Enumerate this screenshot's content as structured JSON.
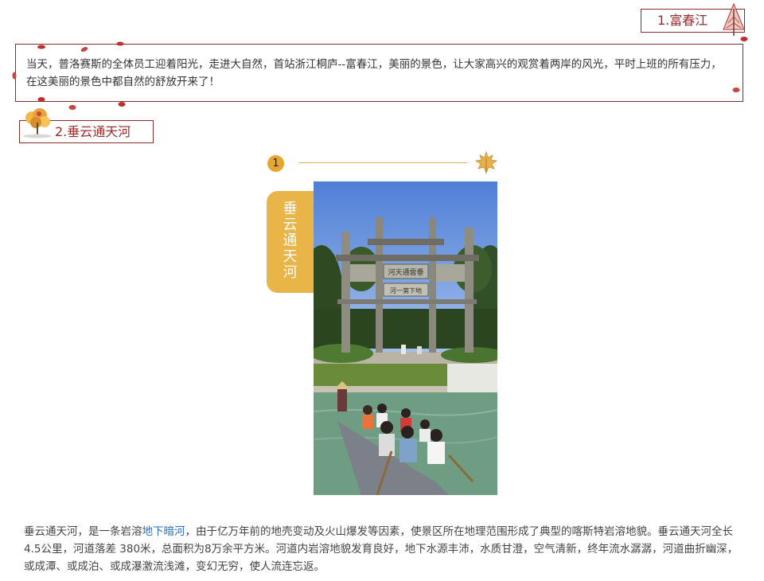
{
  "sections": {
    "s1": {
      "title": "1.富春江"
    },
    "s2": {
      "title": "2.垂云通天河"
    }
  },
  "intro": {
    "text": "当天，普洛赛斯的全体员工迎着阳光，走进大自然，首站浙江桐庐--富春江，美丽的景色，让大家高兴的观赏着两岸的风光，平时上班的所有压力，在这美丽的景色中都自然的舒放开来了！"
  },
  "feature": {
    "step_number": "1",
    "vertical_title": [
      "垂",
      "云",
      "通",
      "天",
      "河"
    ],
    "arch_sign_top": "河天通雲垂",
    "arch_sign_bottom": "河一第下地"
  },
  "body": {
    "part1": "垂云通天河，是一条岩溶",
    "link": "地下暗河",
    "part2": "，由于亿万年前的地壳变动及火山爆发等因素，使景区所在地理范围形成了典型的喀斯特岩溶地貌。垂云通天河全长4.5公里，河道落差 380米，总面积为8万余平方米。河道内岩溶地貌发育良好，地下水源丰沛，水质甘澄，空气清新，终年流水潺潺，河道曲折幽深，或成潭、或成泊、或成瀑激流浅滩，变幻无穷，使人流连忘返。"
  },
  "colors": {
    "frame": "#8b2a2a",
    "accent": "#e9b448",
    "petal": "#b9302f",
    "link": "#2a6fc1"
  }
}
